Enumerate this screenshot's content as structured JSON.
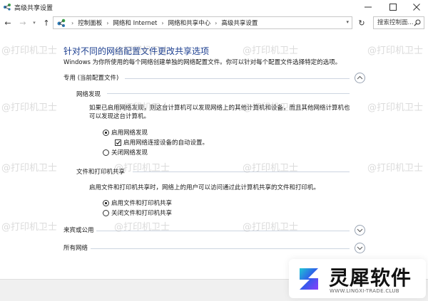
{
  "window": {
    "title": "高级共享设置",
    "minimize_label": "—",
    "maximize_label": "☐",
    "close_label": "✕"
  },
  "nav": {
    "breadcrumbs": [
      "控制面板",
      "网络和 Internet",
      "网络和共享中心",
      "高级共享设置"
    ],
    "search_placeholder": "搜索控制面...",
    "separator": "›"
  },
  "page": {
    "heading": "针对不同的网络配置文件更改共享选项",
    "description": "Windows 为你所使用的每个网络创建单独的网络配置文件。你可以针对每个配置文件选择特定的选项。",
    "profiles": [
      {
        "label": "专用 (当前配置文件)",
        "expanded": true
      },
      {
        "label": "来宾或公用",
        "expanded": false
      },
      {
        "label": "所有网络",
        "expanded": false
      }
    ],
    "network_discovery": {
      "title": "网络发现",
      "description_line1": "如果已启用网络发现，则这台计算机可以发现网络上的其他计算机和设备，而且其他网络计算机也",
      "description_line2": "可以发现这台计算机。",
      "options": [
        {
          "label": "启用网络发现",
          "selected": true
        },
        {
          "label": "关闭网络发现",
          "selected": false
        }
      ],
      "auto_setup_label": "启用网络连接设备的自动设置。",
      "auto_setup_checked": true
    },
    "file_printer_sharing": {
      "title": "文件和打印机共享",
      "description": "启用文件和打印机共享时，网络上的用户可以访问通过此计算机共享的文件和打印机。",
      "options": [
        {
          "label": "启用文件和打印机共享",
          "selected": true
        },
        {
          "label": "关闭文件和打印机共享",
          "selected": false
        }
      ]
    }
  },
  "watermark_text": "@打印机卫士",
  "brand": {
    "name": "灵犀软件",
    "url": "WWW.LINGXI-TRADE.CLUB",
    "colors": [
      "#1fc7d4",
      "#2f5bea",
      "#8a3ffc"
    ]
  },
  "colors": {
    "heading": "#1a3d8f",
    "section_line": "#cdd5e1"
  }
}
